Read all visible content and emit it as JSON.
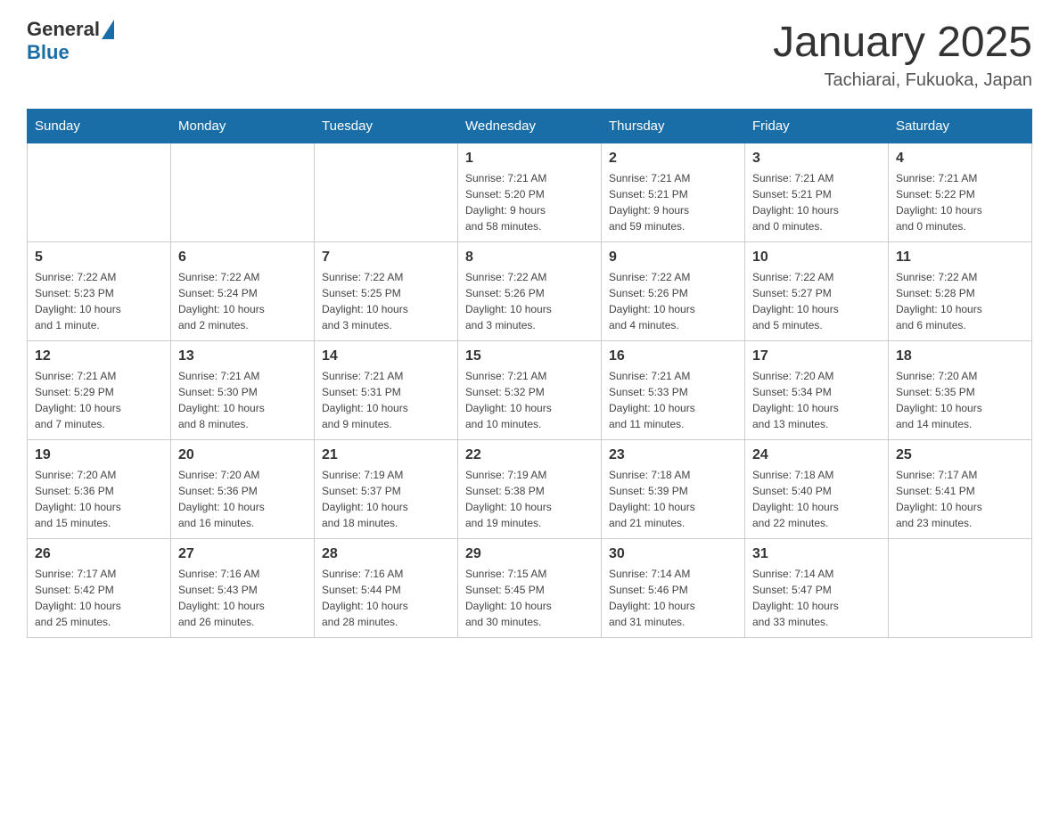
{
  "header": {
    "logo_general": "General",
    "logo_blue": "Blue",
    "month_title": "January 2025",
    "location": "Tachiarai, Fukuoka, Japan"
  },
  "weekdays": [
    "Sunday",
    "Monday",
    "Tuesday",
    "Wednesday",
    "Thursday",
    "Friday",
    "Saturday"
  ],
  "weeks": [
    [
      {
        "day": "",
        "info": ""
      },
      {
        "day": "",
        "info": ""
      },
      {
        "day": "",
        "info": ""
      },
      {
        "day": "1",
        "info": "Sunrise: 7:21 AM\nSunset: 5:20 PM\nDaylight: 9 hours\nand 58 minutes."
      },
      {
        "day": "2",
        "info": "Sunrise: 7:21 AM\nSunset: 5:21 PM\nDaylight: 9 hours\nand 59 minutes."
      },
      {
        "day": "3",
        "info": "Sunrise: 7:21 AM\nSunset: 5:21 PM\nDaylight: 10 hours\nand 0 minutes."
      },
      {
        "day": "4",
        "info": "Sunrise: 7:21 AM\nSunset: 5:22 PM\nDaylight: 10 hours\nand 0 minutes."
      }
    ],
    [
      {
        "day": "5",
        "info": "Sunrise: 7:22 AM\nSunset: 5:23 PM\nDaylight: 10 hours\nand 1 minute."
      },
      {
        "day": "6",
        "info": "Sunrise: 7:22 AM\nSunset: 5:24 PM\nDaylight: 10 hours\nand 2 minutes."
      },
      {
        "day": "7",
        "info": "Sunrise: 7:22 AM\nSunset: 5:25 PM\nDaylight: 10 hours\nand 3 minutes."
      },
      {
        "day": "8",
        "info": "Sunrise: 7:22 AM\nSunset: 5:26 PM\nDaylight: 10 hours\nand 3 minutes."
      },
      {
        "day": "9",
        "info": "Sunrise: 7:22 AM\nSunset: 5:26 PM\nDaylight: 10 hours\nand 4 minutes."
      },
      {
        "day": "10",
        "info": "Sunrise: 7:22 AM\nSunset: 5:27 PM\nDaylight: 10 hours\nand 5 minutes."
      },
      {
        "day": "11",
        "info": "Sunrise: 7:22 AM\nSunset: 5:28 PM\nDaylight: 10 hours\nand 6 minutes."
      }
    ],
    [
      {
        "day": "12",
        "info": "Sunrise: 7:21 AM\nSunset: 5:29 PM\nDaylight: 10 hours\nand 7 minutes."
      },
      {
        "day": "13",
        "info": "Sunrise: 7:21 AM\nSunset: 5:30 PM\nDaylight: 10 hours\nand 8 minutes."
      },
      {
        "day": "14",
        "info": "Sunrise: 7:21 AM\nSunset: 5:31 PM\nDaylight: 10 hours\nand 9 minutes."
      },
      {
        "day": "15",
        "info": "Sunrise: 7:21 AM\nSunset: 5:32 PM\nDaylight: 10 hours\nand 10 minutes."
      },
      {
        "day": "16",
        "info": "Sunrise: 7:21 AM\nSunset: 5:33 PM\nDaylight: 10 hours\nand 11 minutes."
      },
      {
        "day": "17",
        "info": "Sunrise: 7:20 AM\nSunset: 5:34 PM\nDaylight: 10 hours\nand 13 minutes."
      },
      {
        "day": "18",
        "info": "Sunrise: 7:20 AM\nSunset: 5:35 PM\nDaylight: 10 hours\nand 14 minutes."
      }
    ],
    [
      {
        "day": "19",
        "info": "Sunrise: 7:20 AM\nSunset: 5:36 PM\nDaylight: 10 hours\nand 15 minutes."
      },
      {
        "day": "20",
        "info": "Sunrise: 7:20 AM\nSunset: 5:36 PM\nDaylight: 10 hours\nand 16 minutes."
      },
      {
        "day": "21",
        "info": "Sunrise: 7:19 AM\nSunset: 5:37 PM\nDaylight: 10 hours\nand 18 minutes."
      },
      {
        "day": "22",
        "info": "Sunrise: 7:19 AM\nSunset: 5:38 PM\nDaylight: 10 hours\nand 19 minutes."
      },
      {
        "day": "23",
        "info": "Sunrise: 7:18 AM\nSunset: 5:39 PM\nDaylight: 10 hours\nand 21 minutes."
      },
      {
        "day": "24",
        "info": "Sunrise: 7:18 AM\nSunset: 5:40 PM\nDaylight: 10 hours\nand 22 minutes."
      },
      {
        "day": "25",
        "info": "Sunrise: 7:17 AM\nSunset: 5:41 PM\nDaylight: 10 hours\nand 23 minutes."
      }
    ],
    [
      {
        "day": "26",
        "info": "Sunrise: 7:17 AM\nSunset: 5:42 PM\nDaylight: 10 hours\nand 25 minutes."
      },
      {
        "day": "27",
        "info": "Sunrise: 7:16 AM\nSunset: 5:43 PM\nDaylight: 10 hours\nand 26 minutes."
      },
      {
        "day": "28",
        "info": "Sunrise: 7:16 AM\nSunset: 5:44 PM\nDaylight: 10 hours\nand 28 minutes."
      },
      {
        "day": "29",
        "info": "Sunrise: 7:15 AM\nSunset: 5:45 PM\nDaylight: 10 hours\nand 30 minutes."
      },
      {
        "day": "30",
        "info": "Sunrise: 7:14 AM\nSunset: 5:46 PM\nDaylight: 10 hours\nand 31 minutes."
      },
      {
        "day": "31",
        "info": "Sunrise: 7:14 AM\nSunset: 5:47 PM\nDaylight: 10 hours\nand 33 minutes."
      },
      {
        "day": "",
        "info": ""
      }
    ]
  ]
}
